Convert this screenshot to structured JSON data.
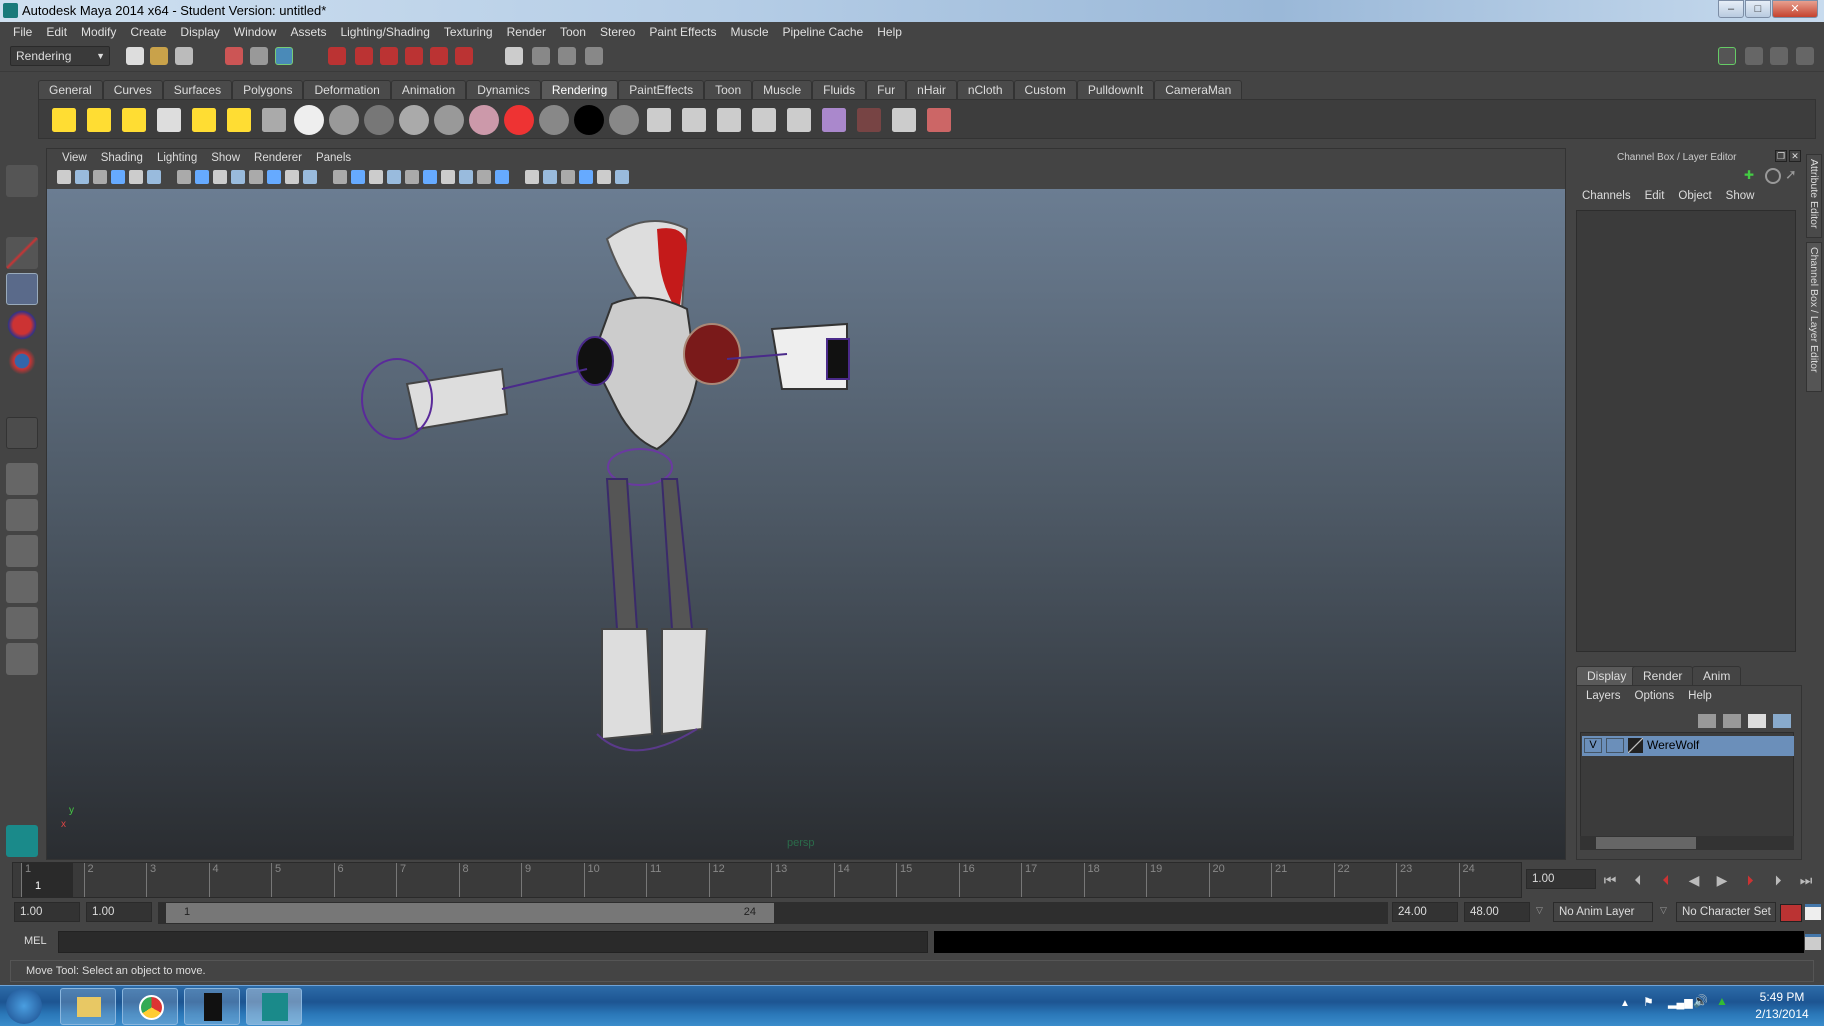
{
  "window": {
    "title": "Autodesk Maya 2014 x64 - Student Version: untitled*"
  },
  "menu": [
    "File",
    "Edit",
    "Modify",
    "Create",
    "Display",
    "Window",
    "Assets",
    "Lighting/Shading",
    "Texturing",
    "Render",
    "Toon",
    "Stereo",
    "Paint Effects",
    "Muscle",
    "Pipeline Cache",
    "Help"
  ],
  "statusline": {
    "menu_set": "Rendering"
  },
  "shelf": {
    "tabs": [
      "General",
      "Curves",
      "Surfaces",
      "Polygons",
      "Deformation",
      "Animation",
      "Dynamics",
      "Rendering",
      "PaintEffects",
      "Toon",
      "Muscle",
      "Fluids",
      "Fur",
      "nHair",
      "nCloth",
      "Custom",
      "PulldownIt",
      "CameraMan"
    ],
    "active": "Rendering"
  },
  "viewport": {
    "menu": [
      "View",
      "Shading",
      "Lighting",
      "Show",
      "Renderer",
      "Panels"
    ],
    "camera_label": "persp",
    "axis": {
      "x": "x",
      "y": "y"
    }
  },
  "channel_box": {
    "title": "Channel Box / Layer Editor",
    "menu": [
      "Channels",
      "Edit",
      "Object",
      "Show"
    ]
  },
  "layer_editor": {
    "tabs": [
      "Display",
      "Render",
      "Anim"
    ],
    "active_tab": "Display",
    "menu": [
      "Layers",
      "Options",
      "Help"
    ],
    "layers": [
      {
        "visible": "V",
        "name": "WereWolf"
      }
    ]
  },
  "side_tabs": [
    "Attribute Editor",
    "Channel Box / Layer Editor"
  ],
  "timeline": {
    "ticks": [
      "1",
      "2",
      "3",
      "4",
      "5",
      "6",
      "7",
      "8",
      "9",
      "10",
      "11",
      "12",
      "13",
      "14",
      "15",
      "16",
      "17",
      "18",
      "19",
      "20",
      "21",
      "22",
      "23",
      "24"
    ],
    "current_frame_marker": "1",
    "current_time": "1.00"
  },
  "range": {
    "start": "1.00",
    "playback_start": "1.00",
    "slider_start": "1",
    "slider_end": "24",
    "playback_end": "24.00",
    "end": "48.00",
    "anim_layer": "No Anim Layer",
    "character_set": "No Character Set"
  },
  "command_line": {
    "label": "MEL",
    "value": ""
  },
  "help_line": "Move Tool: Select an object to move.",
  "taskbar": {
    "time": "5:49 PM",
    "date": "2/13/2014",
    "apps": [
      "start",
      "explorer",
      "chrome",
      "werewolf-app",
      "maya"
    ]
  },
  "colors": {
    "accent_layer": "#6b8fba",
    "key_red": "#c03030"
  }
}
